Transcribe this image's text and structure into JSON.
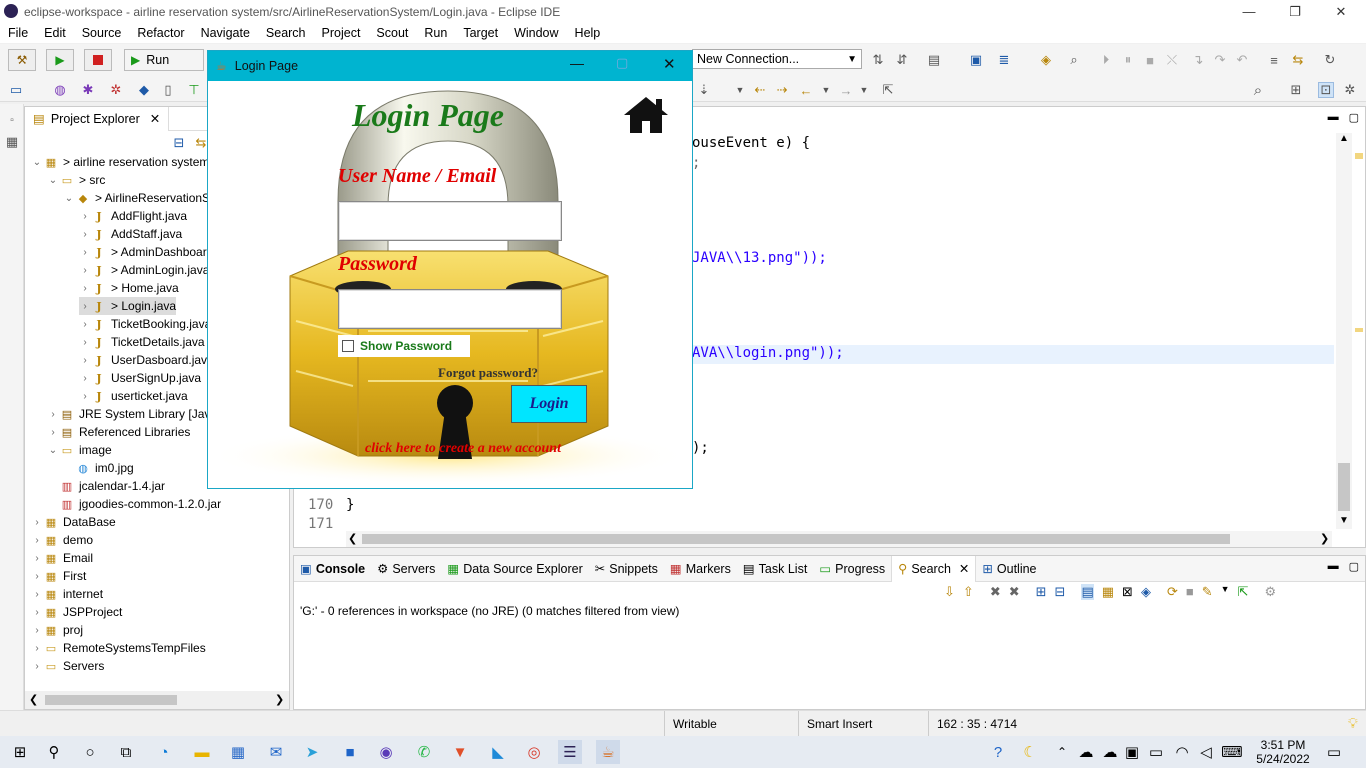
{
  "window": {
    "title": "eclipse-workspace - airline reservation system/src/AirlineReservationSystem/Login.java - Eclipse IDE"
  },
  "menu": [
    "File",
    "Edit",
    "Source",
    "Refactor",
    "Navigate",
    "Search",
    "Project",
    "Scout",
    "Run",
    "Target",
    "Window",
    "Help"
  ],
  "toolbar": {
    "run_label": "Run",
    "connection_value": "New Connection..."
  },
  "explorer": {
    "tab": "Project Explorer",
    "items": [
      {
        "label": "> airline reservation system",
        "depth": 0,
        "arrow": "v",
        "icon": "project"
      },
      {
        "label": "> src",
        "depth": 1,
        "arrow": "v",
        "icon": "folder"
      },
      {
        "label": "> AirlineReservationS",
        "depth": 2,
        "arrow": "v",
        "icon": "package"
      },
      {
        "label": "AddFlight.java",
        "depth": 3,
        "arrow": ">",
        "icon": "java"
      },
      {
        "label": "AddStaff.java",
        "depth": 3,
        "arrow": ">",
        "icon": "java"
      },
      {
        "label": "> AdminDashboar",
        "depth": 3,
        "arrow": ">",
        "icon": "java"
      },
      {
        "label": "> AdminLogin.java",
        "depth": 3,
        "arrow": ">",
        "icon": "java"
      },
      {
        "label": "> Home.java",
        "depth": 3,
        "arrow": ">",
        "icon": "java"
      },
      {
        "label": "> Login.java",
        "depth": 3,
        "arrow": ">",
        "icon": "java",
        "selected": true
      },
      {
        "label": "TicketBooking.java",
        "depth": 3,
        "arrow": ">",
        "icon": "java"
      },
      {
        "label": "TicketDetails.java",
        "depth": 3,
        "arrow": ">",
        "icon": "java"
      },
      {
        "label": "UserDasboard.java",
        "depth": 3,
        "arrow": ">",
        "icon": "java"
      },
      {
        "label": "UserSignUp.java",
        "depth": 3,
        "arrow": ">",
        "icon": "java"
      },
      {
        "label": "userticket.java",
        "depth": 3,
        "arrow": ">",
        "icon": "java"
      },
      {
        "label": "JRE System Library [Java",
        "depth": 1,
        "arrow": ">",
        "icon": "library"
      },
      {
        "label": "Referenced Libraries",
        "depth": 1,
        "arrow": ">",
        "icon": "library"
      },
      {
        "label": "image",
        "depth": 1,
        "arrow": "v",
        "icon": "folder"
      },
      {
        "label": "im0.jpg",
        "depth": 2,
        "arrow": "",
        "icon": "image"
      },
      {
        "label": "jcalendar-1.4.jar",
        "depth": 1,
        "arrow": "",
        "icon": "jar"
      },
      {
        "label": "jgoodies-common-1.2.0.jar",
        "depth": 1,
        "arrow": "",
        "icon": "jar"
      },
      {
        "label": "DataBase",
        "depth": 0,
        "arrow": ">",
        "icon": "project"
      },
      {
        "label": "demo",
        "depth": 0,
        "arrow": ">",
        "icon": "project"
      },
      {
        "label": "Email",
        "depth": 0,
        "arrow": ">",
        "icon": "project"
      },
      {
        "label": "First",
        "depth": 0,
        "arrow": ">",
        "icon": "project"
      },
      {
        "label": "internet",
        "depth": 0,
        "arrow": ">",
        "icon": "project"
      },
      {
        "label": "JSPProject",
        "depth": 0,
        "arrow": ">",
        "icon": "project"
      },
      {
        "label": "proj",
        "depth": 0,
        "arrow": ">",
        "icon": "project"
      },
      {
        "label": "RemoteSystemsTempFiles",
        "depth": 0,
        "arrow": ">",
        "icon": "folder"
      },
      {
        "label": "Servers",
        "depth": 0,
        "arrow": ">",
        "icon": "folder"
      }
    ]
  },
  "editor": {
    "frag1": "ouseEvent e) {",
    "frag2": "JAVA\\\\13.png\"));",
    "frag3": "AVA\\\\login.png\"));",
    "frag4": ");",
    "line170": "170",
    "code170": "}",
    "line171": "171"
  },
  "bottom_tabs": [
    "Console",
    "Servers",
    "Data Source Explorer",
    "Snippets",
    "Markers",
    "Task List",
    "Progress",
    "Search",
    "Outline"
  ],
  "search_result": "'G:' - 0 references in workspace (no JRE) (0 matches filtered from view)",
  "status": {
    "writable": "Writable",
    "insert": "Smart Insert",
    "position": "162 : 35 : 4714"
  },
  "taskbar": {
    "time": "3:51 PM",
    "date": "5/24/2022"
  },
  "dialog": {
    "window_title": "Login Page",
    "heading": "Login Page",
    "user_label": "User Name / Email",
    "user_value": "",
    "password_label": "Password",
    "password_value": "",
    "show_password": "Show Password",
    "forgot": "Forgot password?",
    "login_button": "Login",
    "create_account": "click here to create a new account"
  },
  "colors": {
    "dialog_title": "#00b4d0",
    "heading": "#1a7a1a",
    "label": "#e00000",
    "login_button": "#00e5ff"
  }
}
